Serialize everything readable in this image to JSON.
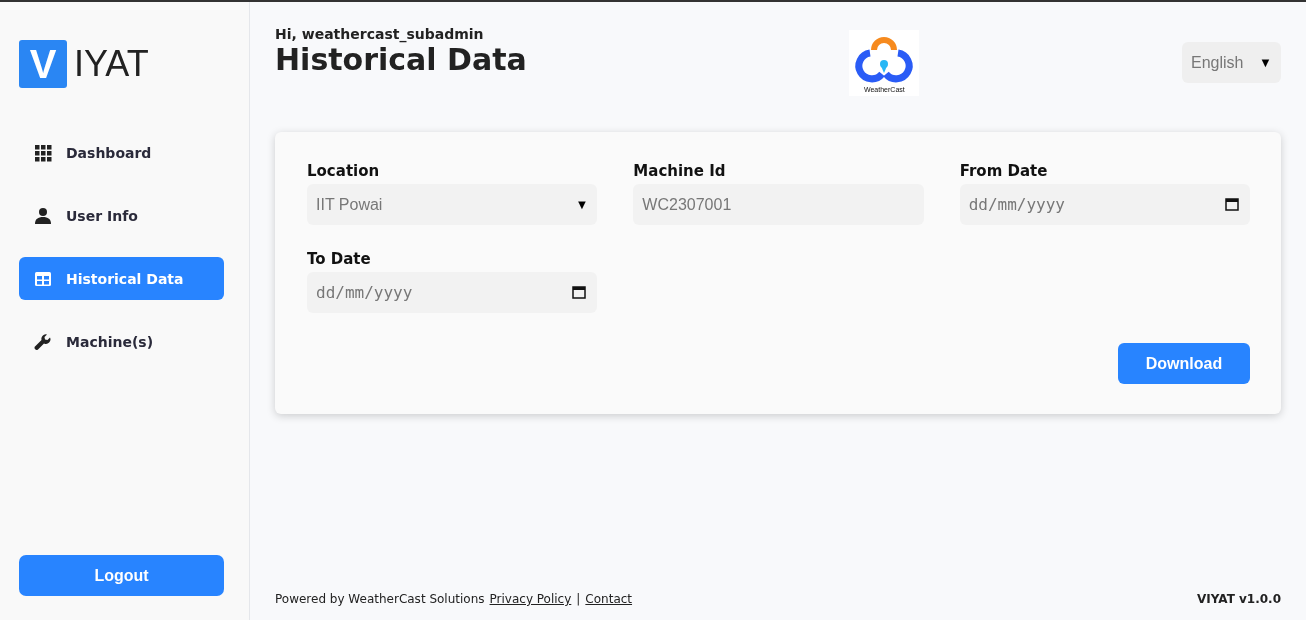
{
  "brand": {
    "initial": "V",
    "rest": "IYAT"
  },
  "nav": [
    {
      "label": "Dashboard",
      "selected": false
    },
    {
      "label": "User Info",
      "selected": false
    },
    {
      "label": "Historical Data",
      "selected": true
    },
    {
      "label": "Machine(s)",
      "selected": false
    }
  ],
  "logout": "Logout",
  "greeting": "Hi, weathercast_subadmin",
  "page_title": "Historical Data",
  "partner_logo": {
    "caption": "WeatherCast"
  },
  "language": {
    "value": "English",
    "caret": "▼"
  },
  "form": {
    "fields": [
      {
        "kind": "select",
        "label": "Location",
        "value": "IIT Powai",
        "caret": "▼"
      },
      {
        "kind": "text",
        "label": "Machine Id",
        "value": "WC2307001"
      },
      {
        "kind": "date",
        "label": "From Date",
        "placeholder": "dd/mm/yyyy"
      },
      {
        "kind": "date",
        "label": "To Date",
        "placeholder": "dd/mm/yyyy"
      }
    ],
    "button": "Download"
  },
  "footer": {
    "powered": "Powered by WeatherCast Solutions",
    "links": [
      "Privacy Policy",
      "Contact"
    ],
    "separator": "|",
    "version": "VIYAT v1.0.0"
  }
}
